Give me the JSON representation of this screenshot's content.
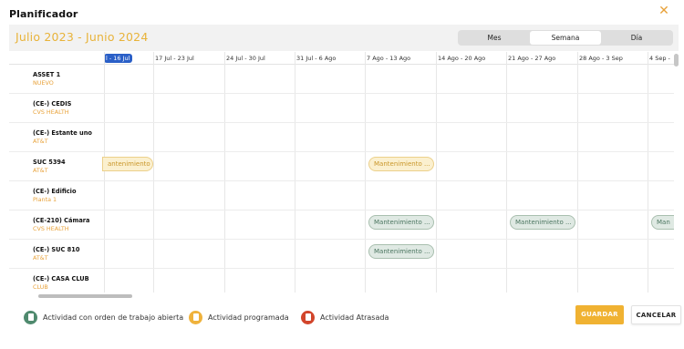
{
  "dialog": {
    "title": "Planificador",
    "close_label": "✕"
  },
  "toolbar": {
    "range_label": "Julio 2023 - Junio 2024",
    "views": [
      {
        "label": "Mes",
        "active": false
      },
      {
        "label": "Semana",
        "active": true
      },
      {
        "label": "Día",
        "active": false
      }
    ]
  },
  "columns": [
    "l - 16 Jul",
    "17 Jul - 23 Jul",
    "24 Jul - 30 Jul",
    "31 Jul - 6 Ago",
    "7 Ago - 13 Ago",
    "14 Ago - 20 Ago",
    "21 Ago - 27 Ago",
    "28 Ago - 3 Sep",
    "4 Sep -"
  ],
  "rows": [
    {
      "name": "ASSET 1",
      "client": "NUEVO"
    },
    {
      "name": "(CE-) CEDIS",
      "client": "CVS HEALTH"
    },
    {
      "name": "(CE-) Estante uno",
      "client": "AT&T"
    },
    {
      "name": "SUC 5394",
      "client": "AT&T"
    },
    {
      "name": "(CE-) Edificio",
      "client": "Planta 1"
    },
    {
      "name": "(CE-210) Cámara",
      "client": "CVS HEALTH"
    },
    {
      "name": "(CE-) SUC 810",
      "client": "AT&T"
    },
    {
      "name": "(CE-) CASA CLUB",
      "client": "CLUB"
    }
  ],
  "events": [
    {
      "row": 3,
      "col": 0,
      "label": "antenimiento ...",
      "status": "programada"
    },
    {
      "row": 3,
      "col": 4,
      "label": "Mantenimiento ...",
      "status": "programada"
    },
    {
      "row": 5,
      "col": 4,
      "label": "Mantenimiento ...",
      "status": "abierta"
    },
    {
      "row": 5,
      "col": 6,
      "label": "Mantenimiento ...",
      "status": "abierta"
    },
    {
      "row": 5,
      "col": 8,
      "label": "Man",
      "status": "abierta"
    },
    {
      "row": 6,
      "col": 4,
      "label": "Mantenimiento ...",
      "status": "abierta"
    }
  ],
  "legend": [
    {
      "label": "Actividad con orden de trabajo abierta",
      "color": "#4f8a6e",
      "icon": "clipboard-icon"
    },
    {
      "label": "Actividad programada",
      "color": "#efb23c",
      "icon": "clipboard-icon"
    },
    {
      "label": "Actividad Atrasada",
      "color": "#d2452b",
      "icon": "clipboard-icon"
    }
  ],
  "actions": {
    "save_label": "GUARDAR",
    "cancel_label": "CANCELAR"
  },
  "colors": {
    "accent": "#f0b232",
    "today_badge": "#2a5fc7"
  }
}
